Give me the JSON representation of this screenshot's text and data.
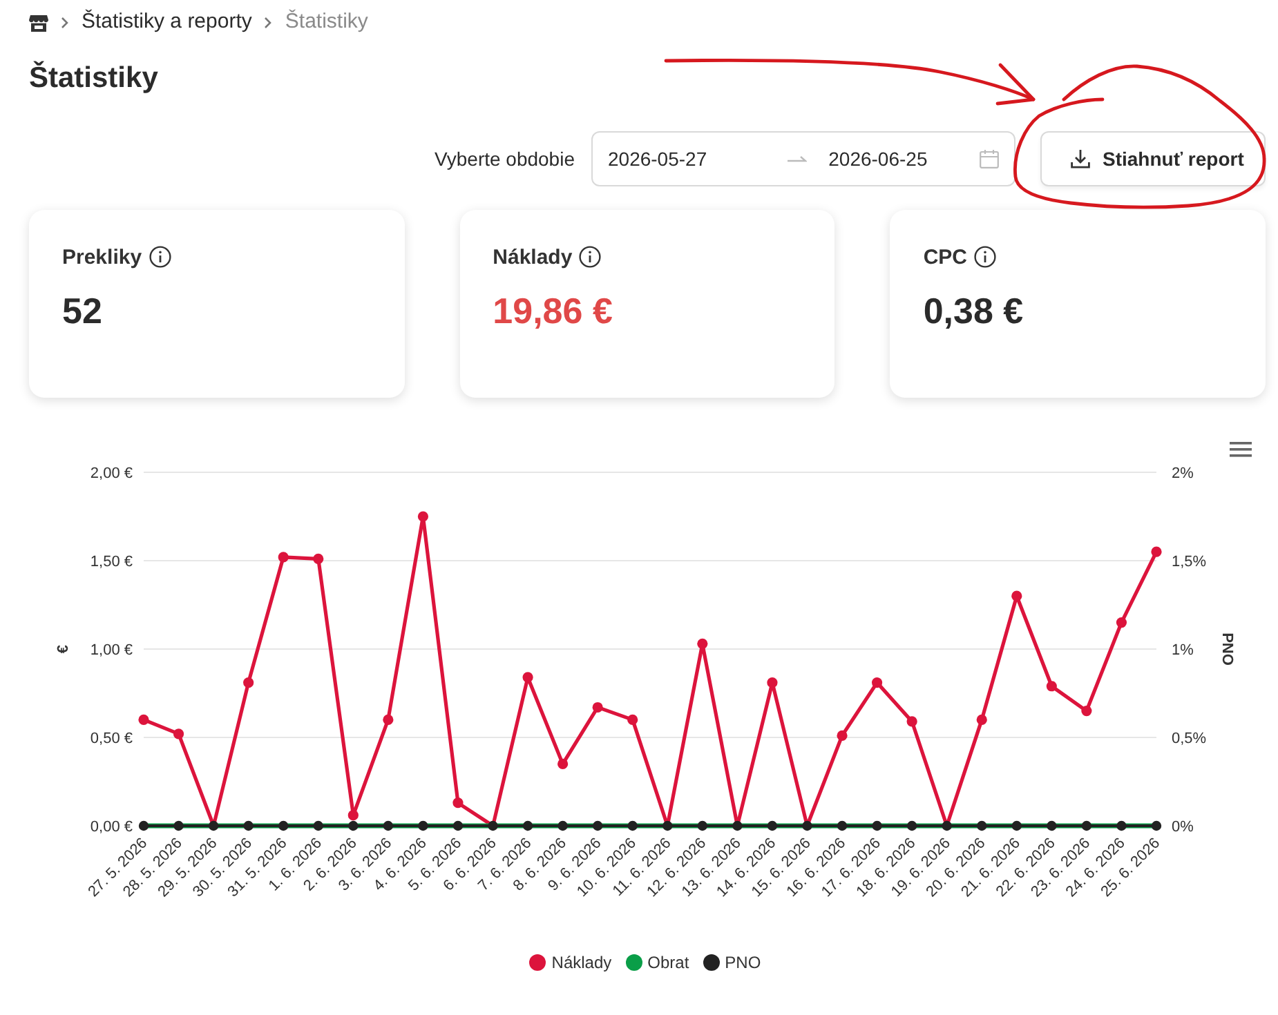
{
  "breadcrumb": {
    "items": [
      {
        "label": "Štatistiky a reporty",
        "current": false
      },
      {
        "label": "Štatistiky",
        "current": true
      }
    ]
  },
  "page_title": "Štatistiky",
  "filter": {
    "label": "Vyberte obdobie",
    "date_range": {
      "start": "2026-05-27",
      "end": "2026-06-25"
    }
  },
  "download_button": {
    "label": "Stiahnuť report"
  },
  "cards": [
    {
      "title": "Prekliky",
      "value": "52",
      "color": "#2b2b2b"
    },
    {
      "title": "Náklady",
      "value": "19,86 €",
      "color": "#e04848"
    },
    {
      "title": "CPC",
      "value": "0,38 €",
      "color": "#2b2b2b"
    }
  ],
  "chart": {
    "right_axis": {
      "label": "PNO",
      "ticks": [
        "2%",
        "1,5%",
        "1%",
        "0,5%",
        "0%"
      ]
    },
    "chart_data": {
      "type": "line",
      "ylabel": "€",
      "grid": true,
      "legend": true,
      "categories": [
        "27. 5. 2026",
        "28. 5. 2026",
        "29. 5. 2026",
        "30. 5. 2026",
        "31. 5. 2026",
        "1. 6. 2026",
        "2. 6. 2026",
        "3. 6. 2026",
        "4. 6. 2026",
        "5. 6. 2026",
        "6. 6. 2026",
        "7. 6. 2026",
        "8. 6. 2026",
        "9. 6. 2026",
        "10. 6. 2026",
        "11. 6. 2026",
        "12. 6. 2026",
        "13. 6. 2026",
        "14. 6. 2026",
        "15. 6. 2026",
        "16. 6. 2026",
        "17. 6. 2026",
        "18. 6. 2026",
        "19. 6. 2026",
        "20. 6. 2026",
        "21. 6. 2026",
        "22. 6. 2026",
        "23. 6. 2026",
        "24. 6. 2026",
        "25. 6. 2026"
      ],
      "series": [
        {
          "name": "Náklady",
          "color": "#dc143c",
          "marker": true,
          "values": [
            0.6,
            0.52,
            0,
            0.81,
            1.52,
            1.51,
            0.06,
            0.6,
            1.75,
            0.13,
            0,
            0.84,
            0.35,
            0.67,
            0.6,
            0,
            1.03,
            0,
            0.81,
            0,
            0.51,
            0.81,
            0.59,
            0,
            0.6,
            1.3,
            0.79,
            0.65,
            1.15,
            1.55
          ]
        },
        {
          "name": "Obrat",
          "color": "#0a9e48",
          "marker": false,
          "values": [
            0,
            0,
            0,
            0,
            0,
            0,
            0,
            0,
            0,
            0,
            0,
            0,
            0,
            0,
            0,
            0,
            0,
            0,
            0,
            0,
            0,
            0,
            0,
            0,
            0,
            0,
            0,
            0,
            0,
            0
          ]
        },
        {
          "name": "PNO",
          "color": "#222222",
          "marker": true,
          "values": [
            0,
            0,
            0,
            0,
            0,
            0,
            0,
            0,
            0,
            0,
            0,
            0,
            0,
            0,
            0,
            0,
            0,
            0,
            0,
            0,
            0,
            0,
            0,
            0,
            0,
            0,
            0,
            0,
            0,
            0
          ]
        }
      ],
      "ylim": [
        0,
        2
      ],
      "yticks": [
        {
          "value": 0,
          "label": "0,00 €"
        },
        {
          "value": 0.5,
          "label": "0,50 €"
        },
        {
          "value": 1,
          "label": "1,00 €"
        },
        {
          "value": 1.5,
          "label": "1,50 €"
        },
        {
          "value": 2,
          "label": "2,00 €"
        }
      ]
    }
  }
}
